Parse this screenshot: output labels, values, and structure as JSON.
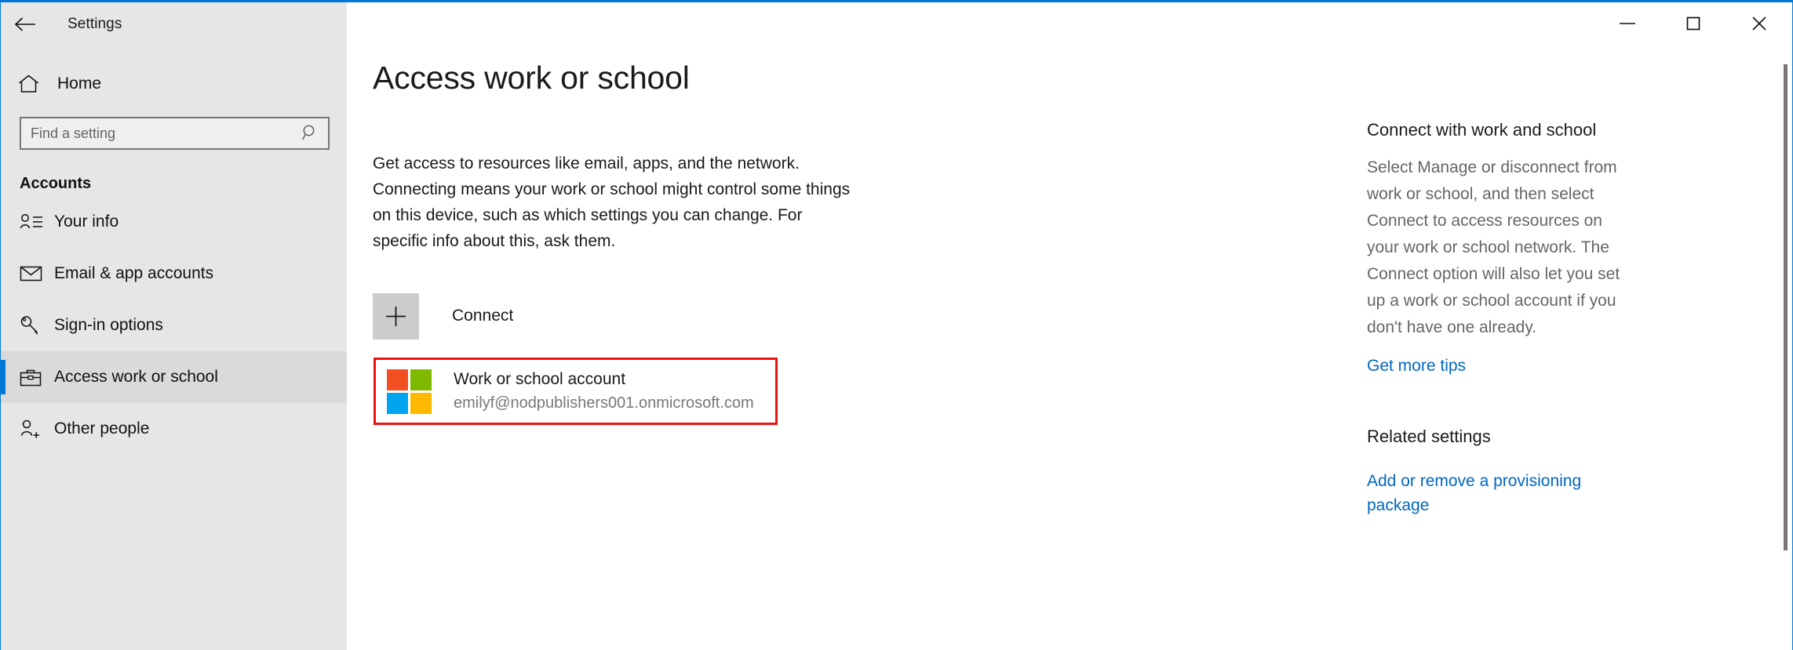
{
  "window": {
    "title": "Settings",
    "accent_color": "#0078d7",
    "back_icon": "back-arrow-icon",
    "controls": {
      "minimize_label": "Minimize",
      "maximize_label": "Maximize",
      "close_label": "Close"
    }
  },
  "sidebar": {
    "home": {
      "label": "Home",
      "icon": "home-icon"
    },
    "search": {
      "value": "",
      "placeholder": "Find a setting",
      "icon": "search-icon"
    },
    "group_title": "Accounts",
    "items": [
      {
        "label": "Your info",
        "icon": "person-list-icon",
        "selected": false
      },
      {
        "label": "Email & app accounts",
        "icon": "envelope-icon",
        "selected": false
      },
      {
        "label": "Sign-in options",
        "icon": "key-icon",
        "selected": false
      },
      {
        "label": "Access work or school",
        "icon": "briefcase-icon",
        "selected": true
      },
      {
        "label": "Other people",
        "icon": "person-add-icon",
        "selected": false
      }
    ]
  },
  "main": {
    "page_title": "Access work or school",
    "intro": "Get access to resources like email, apps, and the network. Connecting means your work or school might control some things on this device, such as which settings you can change. For specific info about this, ask them.",
    "connect": {
      "label": "Connect",
      "icon": "plus-icon"
    },
    "account": {
      "title": "Work or school account",
      "email": "emilyf@nodpublishers001.onmicrosoft.com",
      "icon": "microsoft-logo-icon",
      "highlight_color": "#ee1111",
      "logo_colors": {
        "top_left": "#F25022",
        "top_right": "#7FBA00",
        "bottom_left": "#00A4EF",
        "bottom_right": "#FFB900"
      }
    }
  },
  "right_panel": {
    "section1": {
      "heading": "Connect with work and school",
      "body": "Select Manage or disconnect from work or school, and then select Connect to access resources on your work or school network. The Connect option will also let you set up a work or school account if you don't have one already.",
      "link": "Get more tips"
    },
    "section2": {
      "heading": "Related settings",
      "link": "Add or remove a provisioning package"
    }
  },
  "scrollbar": {
    "name": "vertical-scrollbar"
  }
}
